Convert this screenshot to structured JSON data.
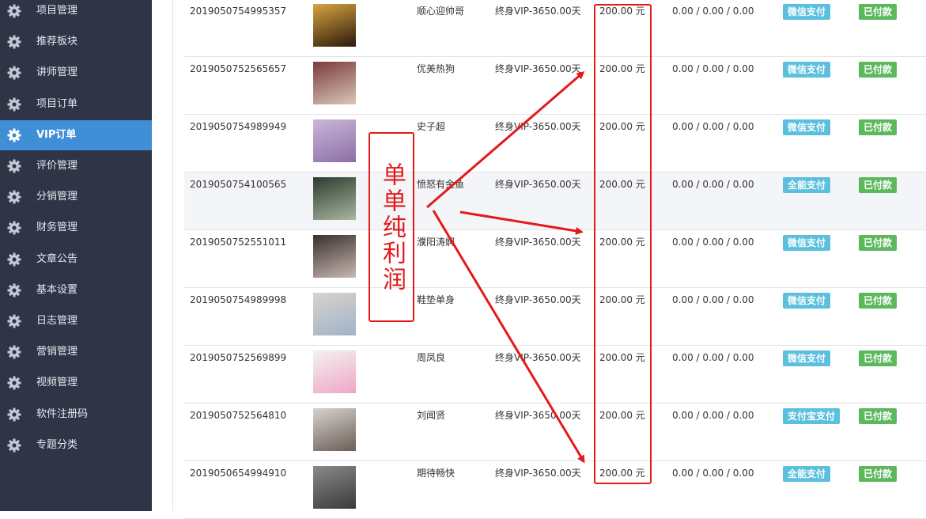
{
  "colors": {
    "sidebar_bg": "#2f3446",
    "sidebar_active": "#3e8fd6",
    "badge_pay": "#5bc0de",
    "badge_paid": "#5cb85c",
    "annotation_red": "#e21a1a"
  },
  "sidebar": {
    "items": [
      {
        "label": "项目管理",
        "icon": "gear-icon"
      },
      {
        "label": "推荐板块",
        "icon": "gear-icon"
      },
      {
        "label": "讲师管理",
        "icon": "gear-icon"
      },
      {
        "label": "项目订单",
        "icon": "gear-icon"
      },
      {
        "label": "VIP订单",
        "icon": "gear-icon",
        "active": true
      },
      {
        "label": "评价管理",
        "icon": "gear-icon"
      },
      {
        "label": "分销管理",
        "icon": "gear-icon"
      },
      {
        "label": "财务管理",
        "icon": "gear-icon"
      },
      {
        "label": "文章公告",
        "icon": "gear-icon"
      },
      {
        "label": "基本设置",
        "icon": "gear-icon"
      },
      {
        "label": "日志管理",
        "icon": "gear-icon"
      },
      {
        "label": "营销管理",
        "icon": "gear-icon"
      },
      {
        "label": "视频管理",
        "icon": "gear-icon"
      },
      {
        "label": "软件注册码",
        "icon": "gear-icon"
      },
      {
        "label": "专题分类",
        "icon": "gear-icon"
      }
    ]
  },
  "orders": [
    {
      "order_no": "2019050754995357",
      "name": "顺心迎帅哥",
      "plan": "终身VIP-3650.00天",
      "price": "200.00 元",
      "split": "0.00 / 0.00 / 0.00",
      "pay_method": "微信支付",
      "status": "已付款"
    },
    {
      "order_no": "2019050752565657",
      "name": "优美热狗",
      "plan": "终身VIP-3650.00天",
      "price": "200.00 元",
      "split": "0.00 / 0.00 / 0.00",
      "pay_method": "微信支付",
      "status": "已付款"
    },
    {
      "order_no": "2019050754989949",
      "name": "史子超",
      "plan": "终身VIP-3650.00天",
      "price": "200.00 元",
      "split": "0.00 / 0.00 / 0.00",
      "pay_method": "微信支付",
      "status": "已付款"
    },
    {
      "order_no": "2019050754100565",
      "name": "愤怒有金鱼",
      "plan": "终身VIP-3650.00天",
      "price": "200.00 元",
      "split": "0.00 / 0.00 / 0.00",
      "pay_method": "全能支付",
      "status": "已付款"
    },
    {
      "order_no": "2019050752551011",
      "name": "濮阳涛婀",
      "plan": "终身VIP-3650.00天",
      "price": "200.00 元",
      "split": "0.00 / 0.00 / 0.00",
      "pay_method": "微信支付",
      "status": "已付款"
    },
    {
      "order_no": "2019050754989998",
      "name": "鞋垫单身",
      "plan": "终身VIP-3650.00天",
      "price": "200.00 元",
      "split": "0.00 / 0.00 / 0.00",
      "pay_method": "微信支付",
      "status": "已付款"
    },
    {
      "order_no": "2019050752569899",
      "name": "周凤良",
      "plan": "终身VIP-3650.00天",
      "price": "200.00 元",
      "split": "0.00 / 0.00 / 0.00",
      "pay_method": "微信支付",
      "status": "已付款"
    },
    {
      "order_no": "2019050752564810",
      "name": "刘闻贤",
      "plan": "终身VIP-3650.00天",
      "price": "200.00 元",
      "split": "0.00 / 0.00 / 0.00",
      "pay_method": "支付宝支付",
      "status": "已付款"
    },
    {
      "order_no": "2019050654994910",
      "name": "期待畅快",
      "plan": "终身VIP-3650.00天",
      "price": "200.00 元",
      "split": "0.00 / 0.00 / 0.00",
      "pay_method": "全能支付",
      "status": "已付款"
    }
  ],
  "annotation": {
    "text": "单单纯利润"
  }
}
